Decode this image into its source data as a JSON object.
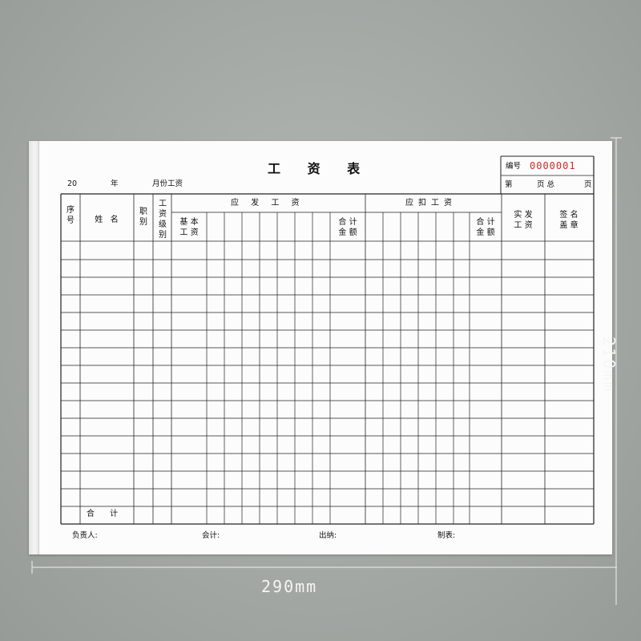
{
  "form": {
    "title": "工 资 表",
    "period_prefix": "20",
    "period_year": "年",
    "period_suffix": "月份工资",
    "serial_label": "编号",
    "serial_number": "0000001",
    "page_prefix": "第",
    "page_middle": "页 总",
    "page_suffix": "页",
    "headers": {
      "seq": "序\n号",
      "name": "姓   名",
      "title": "职\n别",
      "grade": "工\n资\n级\n别",
      "payable": "应 发 工 资",
      "base": "基 本\n工 资",
      "payable_total": "合 计\n金 额",
      "deduct": "应扣工资",
      "deduct_total": "合 计\n金 额",
      "net": "实 发\n工 资",
      "sign": "签 名\n盖 章"
    },
    "total_row_label": "合      计",
    "footer": {
      "manager": "负责人:",
      "accountant": "会计:",
      "cashier": "出纳:",
      "preparer": "制表:"
    }
  },
  "dimensions": {
    "width_label": "290mm",
    "height_label": "210mm"
  },
  "colors": {
    "background": "#a3a7a4",
    "paper": "#fcfcfc",
    "ink": "#111111",
    "serial_red": "#cc2a2a"
  }
}
